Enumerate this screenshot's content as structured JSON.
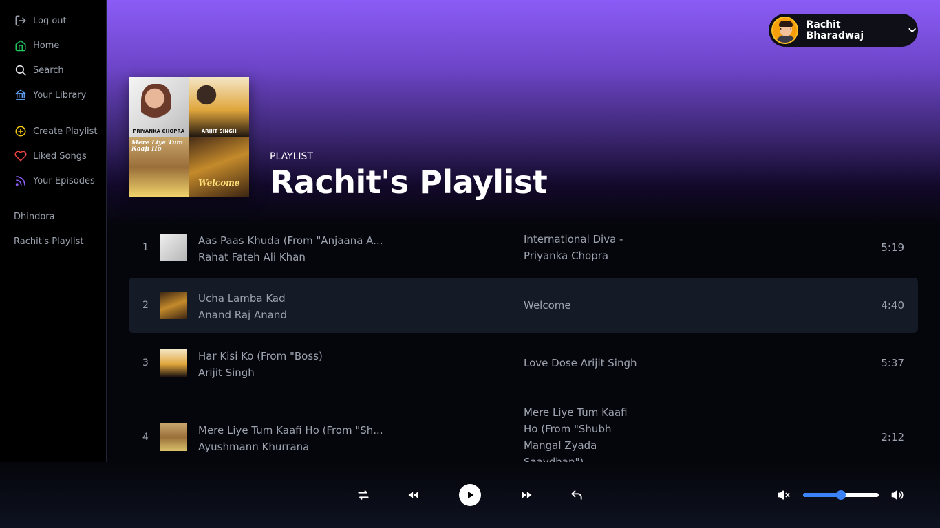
{
  "sidebar": {
    "nav": [
      {
        "label": "Log out",
        "icon": "logout-icon"
      },
      {
        "label": "Home",
        "icon": "home-icon"
      },
      {
        "label": "Search",
        "icon": "search-icon"
      },
      {
        "label": "Your Library",
        "icon": "library-icon"
      }
    ],
    "actions": [
      {
        "label": "Create Playlist",
        "icon": "plus-circle-icon"
      },
      {
        "label": "Liked Songs",
        "icon": "heart-icon"
      },
      {
        "label": "Your Episodes",
        "icon": "rss-icon"
      }
    ],
    "playlists": [
      "Dhindora",
      "Rachit's Playlist"
    ]
  },
  "user": {
    "name": "Rachit Bharadwaj"
  },
  "playlist": {
    "type_label": "PLAYLIST",
    "title": "Rachit's Playlist",
    "cover_captions": [
      "PRIYANKA CHOPRA",
      "ARIJIT SINGH",
      "Mere Liye Tum Kaafi Ho",
      "Welcome"
    ]
  },
  "tracks": [
    {
      "num": "1",
      "title": "Aas Paas Khuda (From \"Anjaana A...",
      "artist": "Rahat Fateh Ali Khan",
      "album": "International Diva - Priyanka Chopra",
      "duration": "5:19",
      "active": false
    },
    {
      "num": "2",
      "title": "Ucha Lamba Kad",
      "artist": "Anand Raj Anand",
      "album": "Welcome",
      "duration": "4:40",
      "active": true
    },
    {
      "num": "3",
      "title": "Har Kisi Ko (From \"Boss)",
      "artist": "Arijit Singh",
      "album": "Love Dose Arijit Singh",
      "duration": "5:37",
      "active": false
    },
    {
      "num": "4",
      "title": "Mere Liye Tum Kaafi Ho (From \"Sh...",
      "artist": "Ayushmann Khurrana",
      "album": "Mere Liye Tum Kaafi Ho (From \"Shubh Mangal Zyada Saavdhan\")",
      "duration": "2:12",
      "active": false
    }
  ],
  "player": {
    "controls": [
      "repeat-icon",
      "previous-icon",
      "play-icon",
      "next-icon",
      "back-icon"
    ],
    "volume": 0.5,
    "colors": {
      "accent": "#3b82f6",
      "hero_top": "#8b5cf6"
    }
  }
}
